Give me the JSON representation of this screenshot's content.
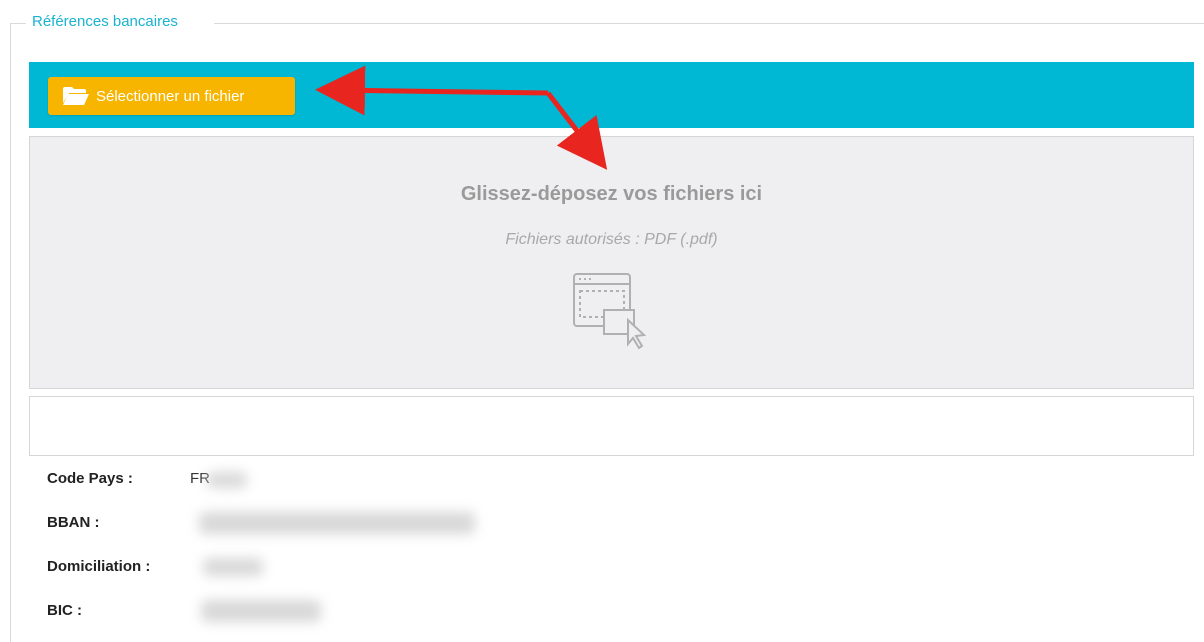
{
  "section": {
    "legend": "Références bancaires"
  },
  "uploader": {
    "select_button_label": "Sélectionner un fichier",
    "dropzone_title": "Glissez-déposez vos fichiers ici",
    "dropzone_subtitle": "Fichiers autorisés : PDF (.pdf)"
  },
  "bank_info": {
    "code_pays_label": "Code Pays :",
    "code_pays_value": "FR",
    "bban_label": "BBAN :",
    "domiciliation_label": "Domiciliation :",
    "bic_label": "BIC :"
  },
  "colors": {
    "accent": "#00b8d4",
    "button": "#f7b500",
    "legend": "#1ab3cf",
    "annotation_arrow": "#e8261f"
  },
  "icons": {
    "select_button": "folder-open-icon",
    "dropzone": "drag-drop-window-icon"
  }
}
